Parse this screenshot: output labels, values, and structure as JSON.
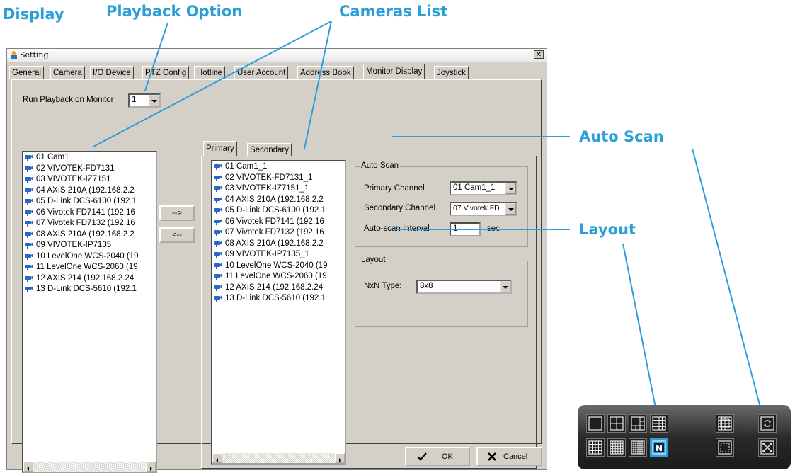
{
  "callouts": {
    "display": "Display",
    "playback_option": "Playback Option",
    "cameras_list": "Cameras List",
    "auto_scan": "Auto Scan",
    "layout": "Layout"
  },
  "window": {
    "title": "Setting",
    "close_glyph": "✕"
  },
  "tabs": [
    "General",
    "Camera",
    "I/O Device",
    "PTZ Config",
    "Hotline",
    "User Account",
    "Address Book",
    "Monitor Display",
    "Joystick"
  ],
  "active_tab": "Monitor Display",
  "playback": {
    "label": "Run Playback on Monitor",
    "value": "1"
  },
  "left_list": [
    "01 Cam1",
    "02 VIVOTEK-FD7131",
    "03 VIVOTEK-IZ7151",
    "04 AXIS 210A (192.168.2.2",
    "05 D-Link DCS-6100 (192.1",
    "06 Vivotek FD7141 (192.16",
    "07 Vivotek FD7132 (192.16",
    "08 AXIS 210A (192.168.2.2",
    "09 VIVOTEK-IP7135",
    "10 LevelOne WCS-2040 (19",
    "11 LevelOne WCS-2060 (19",
    "12 AXIS 214 (192.168.2.24",
    "13 D-Link DCS-5610 (192.1"
  ],
  "move_buttons": {
    "add": "-->",
    "remove": "<--"
  },
  "sub_tabs": [
    "Primary",
    "Secondary"
  ],
  "right_list": [
    "01 Cam1_1",
    "02 VIVOTEK-FD7131_1",
    "03 VIVOTEK-IZ7151_1",
    "04 AXIS 210A (192.168.2.2",
    "05 D-Link DCS-6100 (192.1",
    "06 Vivotek FD7141 (192.16",
    "07 Vivotek FD7132 (192.16",
    "08 AXIS 210A (192.168.2.2",
    "09 VIVOTEK-IP7135_1",
    "10 LevelOne WCS-2040 (19",
    "11 LevelOne WCS-2060 (19",
    "12 AXIS 214 (192.168.2.24",
    "13 D-Link DCS-5610 (192.1"
  ],
  "auto_scan": {
    "title": "Auto Scan",
    "primary_label": "Primary Channel",
    "primary_value": "01 Cam1_1",
    "secondary_label": "Secondary Channel",
    "secondary_value": "07 Vivotek FD",
    "interval_label": "Auto-scan Interval",
    "interval_value": "1",
    "interval_unit": "sec."
  },
  "layout": {
    "title": "Layout",
    "nxn_label": "NxN Type:",
    "nxn_value": "8x8"
  },
  "buttons": {
    "ok": "OK",
    "cancel": "Cancel"
  },
  "colors": {
    "callout": "#2d9fd8",
    "window_bg": "#d4d0c8",
    "highlight": "#2d9fd8"
  },
  "toolbar_icons": [
    "single-view-icon",
    "quad-view-icon",
    "six-view-icon",
    "nine-view-icon",
    "sixteen-view-icon",
    "twenty-five-view-icon",
    "thirty-six-view-icon",
    "nxn-view-icon",
    "full-screen-grid-icon",
    "hide-border-icon",
    "auto-scan-icon",
    "full-screen-icon"
  ]
}
